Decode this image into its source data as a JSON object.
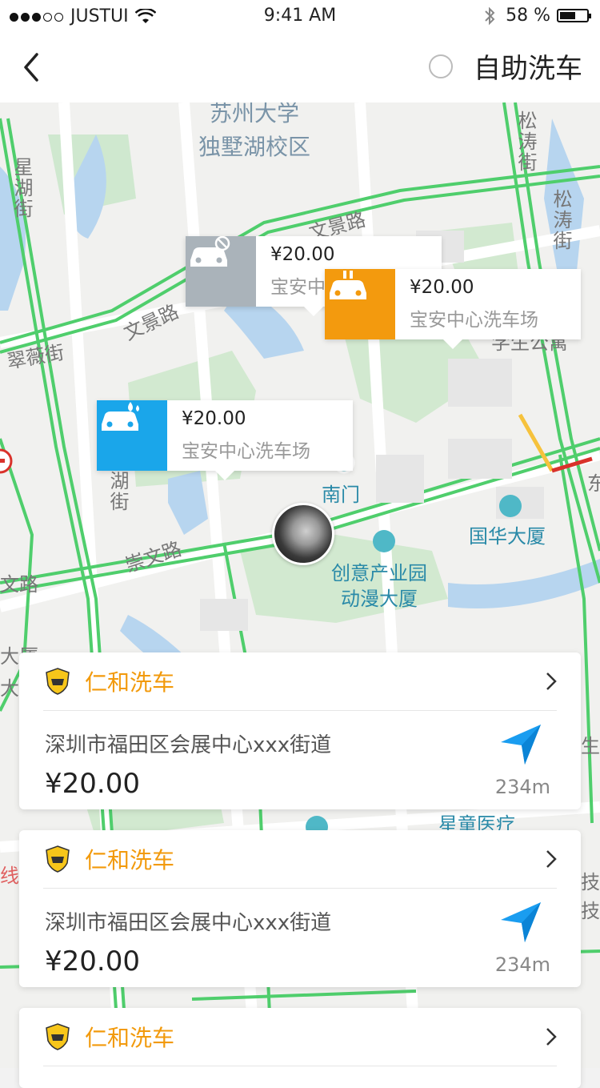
{
  "status_bar": {
    "carrier": "JUSTUI",
    "time": "9:41 AM",
    "battery": "58 %",
    "battery_level": 0.58
  },
  "nav": {
    "self_wash_label": "自助洗车"
  },
  "map": {
    "labels": {
      "university": "苏州大学",
      "campus": "独墅湖校区",
      "wenjing_road_1": "文景路",
      "wenjing_road_2": "文景路",
      "cuiwei_street": "翠薇街",
      "xinghu_street": "星湖街",
      "songtao_street_1": "松涛街",
      "songtao_street_2": "松涛街",
      "hu_street": "湖街",
      "chongwen_road": "崇文路",
      "wen_road": "文路",
      "nanmen": "南门",
      "guohua_building": "国华大厦",
      "chuangyi_1": "创意产业园",
      "chuangyi_2": "动漫大厦",
      "xingtong_medical": "星童医疗",
      "xuesheng": "学生公寓",
      "dong": "东",
      "da_sha": "大厦",
      "da": "大",
      "sheng": "生",
      "ji": "技",
      "ji2": "技",
      "xian": "线"
    },
    "pins": [
      {
        "price": "¥20.00",
        "name": "宝安中心洗车场",
        "icon": "car-disabled-icon",
        "color": "#aab3ba"
      },
      {
        "price": "¥20.00",
        "name": "宝安中心洗车场",
        "icon": "car-charging-icon",
        "color": "#f39a0e"
      },
      {
        "price": "¥20.00",
        "name": "宝安中心洗车场",
        "icon": "car-wash-icon",
        "color": "#1aa6ea"
      }
    ]
  },
  "cards": [
    {
      "shop": "仁和洗车",
      "address": "深圳市福田区会展中心xxx街道",
      "price": "¥20.00",
      "distance": "234m"
    },
    {
      "shop": "仁和洗车",
      "address": "深圳市福田区会展中心xxx街道",
      "price": "¥20.00",
      "distance": "234m"
    },
    {
      "shop": "仁和洗车"
    }
  ]
}
